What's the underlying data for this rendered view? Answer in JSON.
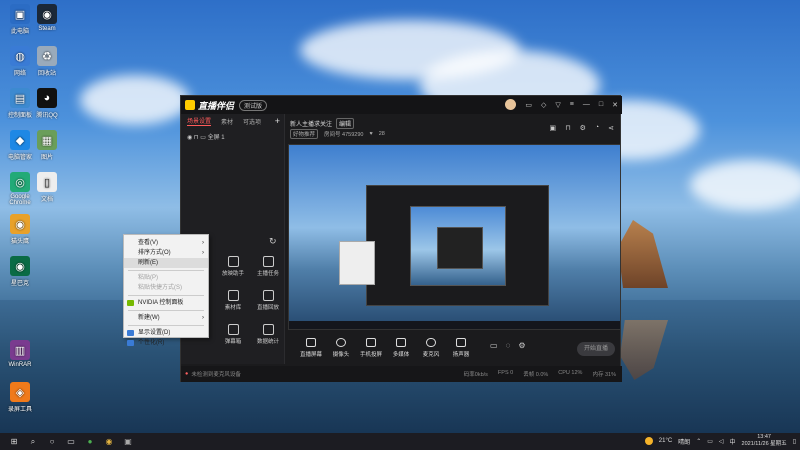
{
  "desktop": {
    "icons": [
      {
        "label": "此电脑",
        "glyph": "▣",
        "color": "#2b6cc4"
      },
      {
        "label": "Steam",
        "glyph": "◉",
        "color": "#1b2838"
      },
      {
        "label": "网络",
        "glyph": "◍",
        "color": "#3a7bd5"
      },
      {
        "label": "回收站",
        "glyph": "♻",
        "color": "#9ab"
      },
      {
        "label": "控制面板",
        "glyph": "▤",
        "color": "#3d8ad0"
      },
      {
        "label": "腾讯QQ",
        "glyph": "◕",
        "color": "#111"
      },
      {
        "label": "电脑管家",
        "glyph": "◆",
        "color": "#1e88e5"
      },
      {
        "label": "图片",
        "glyph": "▦",
        "color": "#6a9e5a"
      },
      {
        "label": "Google Chrome",
        "glyph": "◎",
        "color": "#2a7"
      },
      {
        "label": "文档",
        "glyph": "▯",
        "color": "#eee"
      },
      {
        "label": "猫头鹰",
        "glyph": "◉",
        "color": "#e8a12a"
      },
      {
        "label": "星巴克",
        "glyph": "◉",
        "color": "#0a6b45"
      },
      {
        "label": "WinRAR",
        "glyph": "▥",
        "color": "#7a3b8f"
      },
      {
        "label": "录屏工具",
        "glyph": "◈",
        "color": "#f07a1a"
      }
    ]
  },
  "context_menu": {
    "items": [
      {
        "label": "查看(V)",
        "arrow": "›",
        "type": "normal"
      },
      {
        "label": "排序方式(O)",
        "arrow": "›",
        "type": "normal"
      },
      {
        "label": "刷新(E)",
        "arrow": "",
        "type": "highlight"
      },
      {
        "label": "粘贴(P)",
        "arrow": "",
        "type": "disabled"
      },
      {
        "label": "粘贴快捷方式(S)",
        "arrow": "",
        "type": "disabled"
      },
      {
        "label": "NVIDIA 控制面板",
        "arrow": "",
        "type": "icon",
        "icon_color": "#76b900"
      },
      {
        "label": "新建(W)",
        "arrow": "›",
        "type": "normal"
      },
      {
        "label": "显示设置(D)",
        "arrow": "",
        "type": "icon",
        "icon_color": "#3a7bd5"
      },
      {
        "label": "个性化(R)",
        "arrow": "",
        "type": "icon",
        "icon_color": "#3a7bd5"
      }
    ]
  },
  "app": {
    "name": "直播伴侣",
    "version": "测试版",
    "tabs": [
      "场景设置",
      "素材",
      "可选项"
    ],
    "scene_label": "全屏 1",
    "stream_title": "新人主播求关注",
    "edit_tag": "编辑",
    "category": "好物推荐",
    "room_info": "房间号 4759290",
    "viewers": "28",
    "left_tools": [
      {
        "label": "放映助手"
      },
      {
        "label": "主播任务"
      },
      {
        "label": "素材库"
      },
      {
        "label": "直播回放"
      },
      {
        "label": "弹幕箱"
      },
      {
        "label": "数据统计"
      }
    ],
    "bottom_tools": [
      {
        "label": "直播屏幕"
      },
      {
        "label": "摄像头"
      },
      {
        "label": "手机投屏"
      },
      {
        "label": "多媒体"
      },
      {
        "label": "麦克风"
      },
      {
        "label": "扬声器"
      }
    ],
    "go_live": "开始直播",
    "status_warning": "未检测到麦克风设备",
    "stats": [
      "码率0kb/s",
      "FPS 0",
      "丢帧 0.0%",
      "CPU 12%",
      "内存 31%"
    ]
  },
  "taskbar": {
    "weather_temp": "21°C",
    "weather_desc": "晴朗",
    "time": "13:47",
    "date": "2021/11/26 星期五"
  }
}
